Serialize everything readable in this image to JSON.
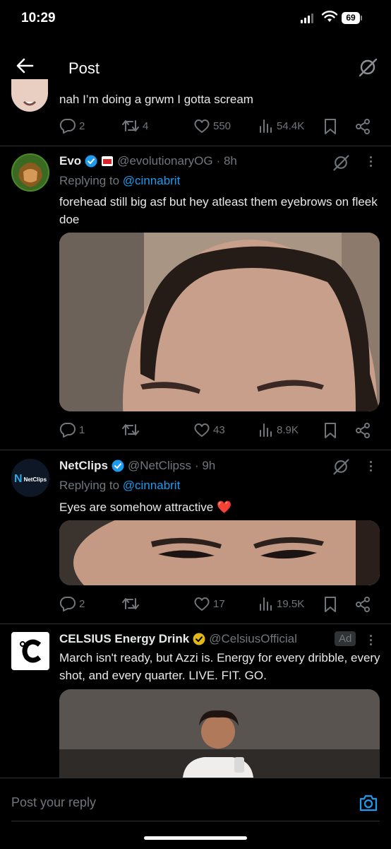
{
  "status_bar": {
    "time": "10:29",
    "battery": "69"
  },
  "header": {
    "title": "Post"
  },
  "prev_post": {
    "text": "nah I’m doing a grwm I gotta scream",
    "replies": "2",
    "reposts": "4",
    "likes": "550",
    "views": "54.4K"
  },
  "posts": [
    {
      "name": "Evo",
      "handle": "@evolutionaryOG",
      "time": "· 8h",
      "replying_label": "Replying to",
      "replying_to": "@cinnabrit",
      "text": "forehead still big asf but hey atleast them eyebrows on fleek doe",
      "replies": "1",
      "reposts": "",
      "likes": "43",
      "views": "8.9K"
    },
    {
      "name": "NetClips",
      "handle": "@NetClipss",
      "time": "· 9h",
      "avatar_text": "NetClips",
      "replying_label": "Replying to",
      "replying_to": "@cinnabrit",
      "text": "Eyes are somehow attractive ❤️",
      "replies": "2",
      "reposts": "",
      "likes": "17",
      "views": "19.5K"
    },
    {
      "name": "CELSIUS Energy Drink",
      "handle": "@CelsiusOfficial",
      "ad_label": "Ad",
      "text": "March isn't ready, but Azzi is. Energy for every dribble, every shot, and every quarter. LIVE. FIT. GO."
    }
  ],
  "compose": {
    "placeholder": "Post your reply"
  },
  "colors": {
    "accent": "#1d9bf0",
    "verified": "#1d9bf0",
    "gold": "#e2b719",
    "muted": "#71767b"
  }
}
